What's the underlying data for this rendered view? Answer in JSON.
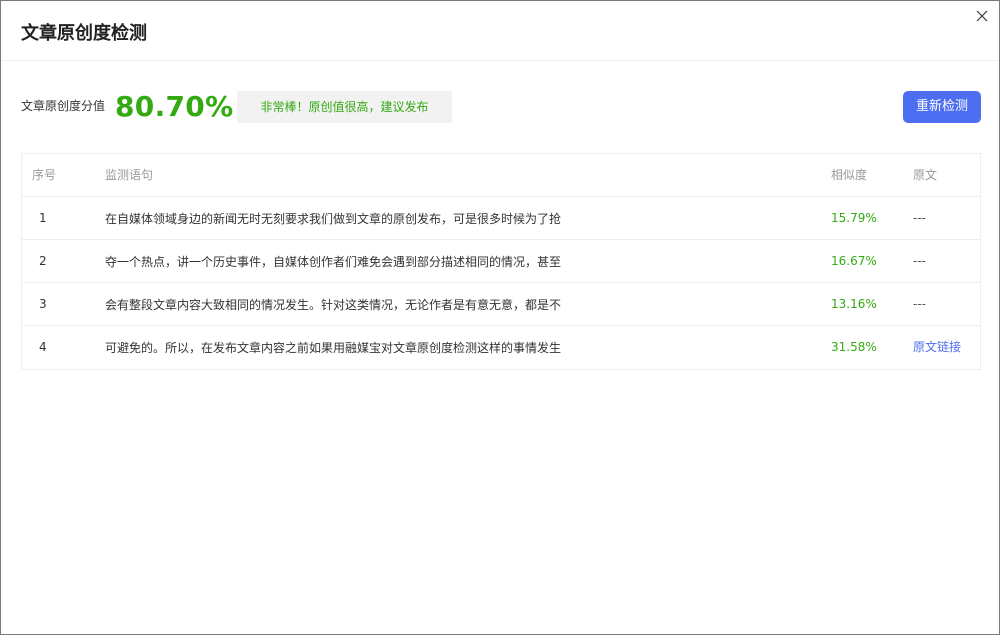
{
  "dialog": {
    "title": "文章原创度检测",
    "close_icon": "close-icon"
  },
  "score": {
    "label": "文章原创度分值",
    "value": "80.70%",
    "badge": "非常棒！原创值很高，建议发布",
    "recheck_label": "重新检测"
  },
  "colors": {
    "accent": "#4e6ef2",
    "success": "#33aa11"
  },
  "table": {
    "headers": {
      "no": "序号",
      "text": "监测语句",
      "similarity": "相似度",
      "source": "原文"
    },
    "rows": [
      {
        "no": "1",
        "text": "在自媒体领域身边的新闻无时无刻要求我们做到文章的原创发布，可是很多时候为了抢",
        "similarity": "15.79%",
        "source": "---"
      },
      {
        "no": "2",
        "text": "夺一个热点，讲一个历史事件，自媒体创作者们难免会遇到部分描述相同的情况，甚至",
        "similarity": "16.67%",
        "source": "---"
      },
      {
        "no": "3",
        "text": "会有整段文章内容大致相同的情况发生。针对这类情况，无论作者是有意无意，都是不",
        "similarity": "13.16%",
        "source": "---"
      },
      {
        "no": "4",
        "text": "可避免的。所以，在发布文章内容之前如果用融媒宝对文章原创度检测这样的事情发生",
        "similarity": "31.58%",
        "source": "原文链接"
      }
    ]
  }
}
